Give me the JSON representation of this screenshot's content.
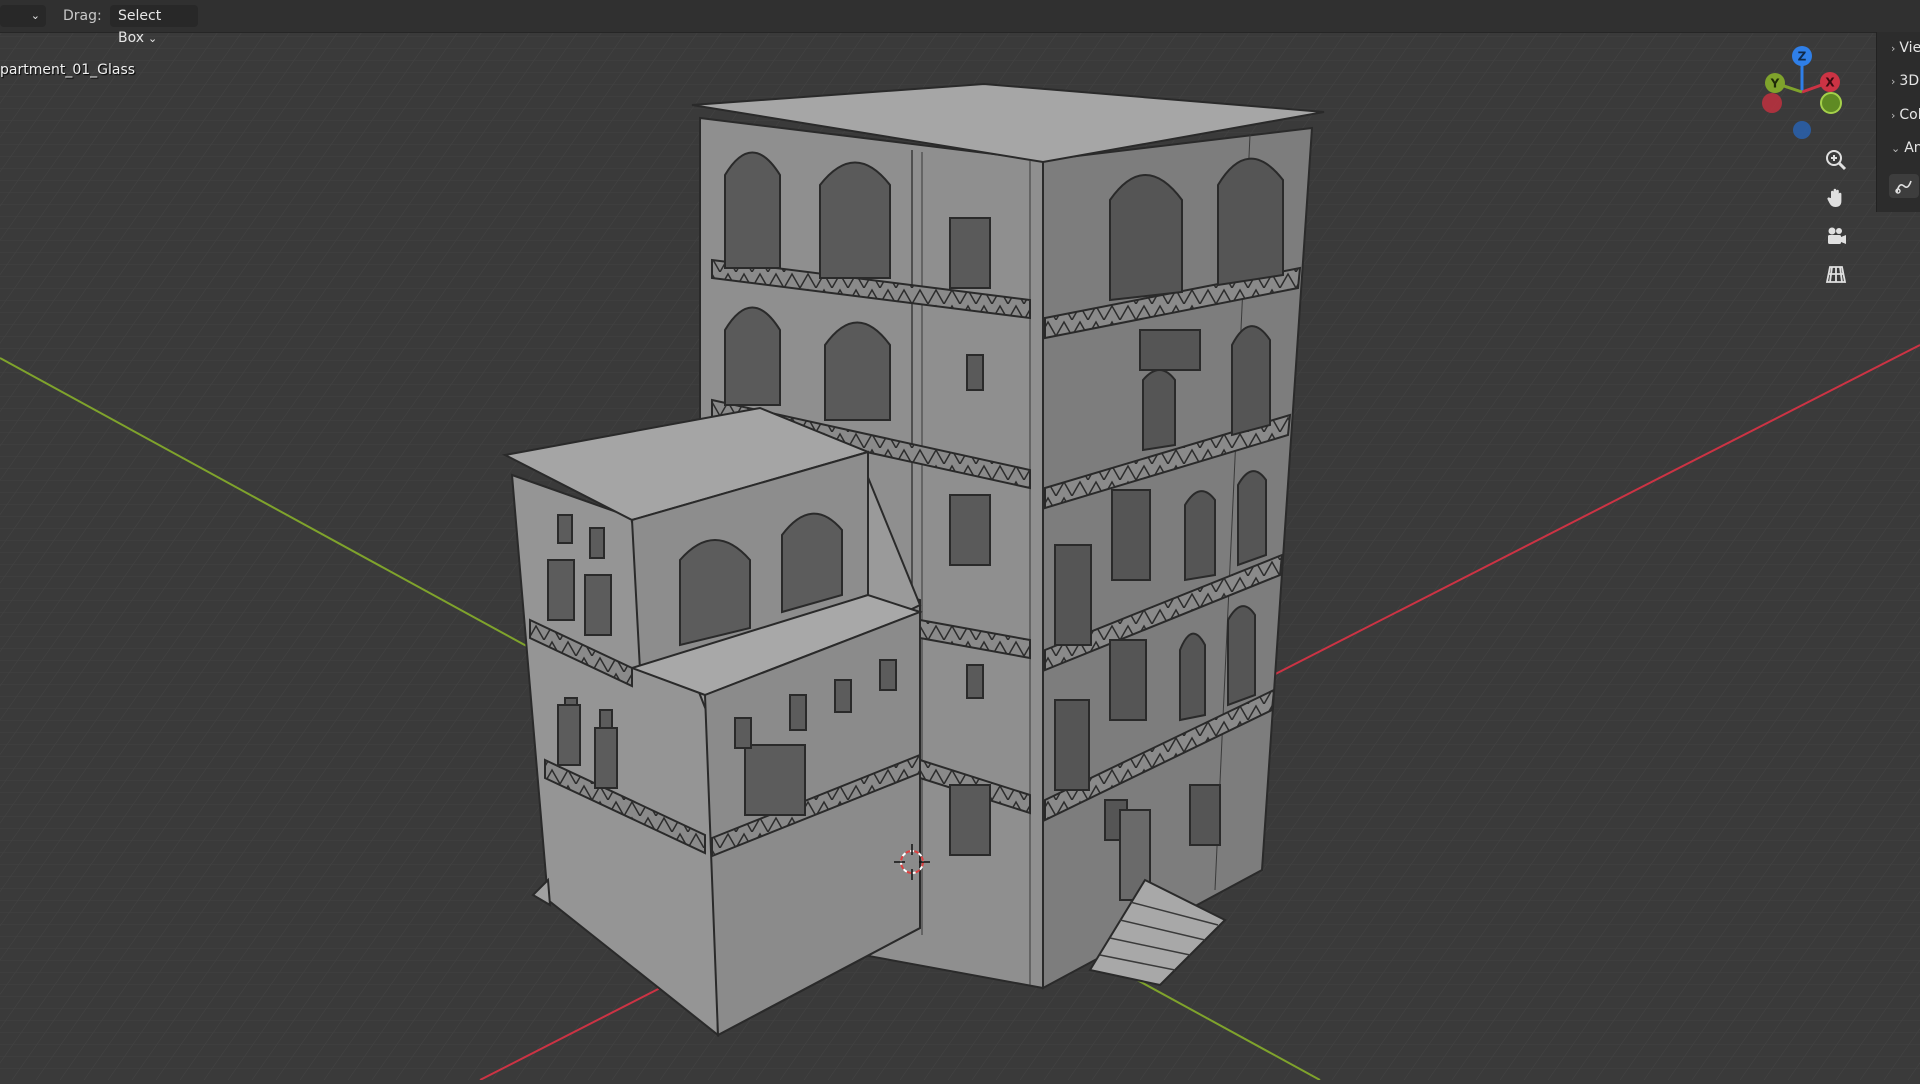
{
  "header": {
    "mode_select": "",
    "drag_label": "Drag:",
    "drag_value": "Select Box"
  },
  "viewport": {
    "object_name": "partment_01_Glass",
    "gizmo": {
      "z": "Z",
      "y": "Y",
      "x": "X"
    }
  },
  "side_panel": {
    "tabs": [
      {
        "label": "Vie"
      },
      {
        "label": "3D"
      },
      {
        "label": "Col"
      },
      {
        "label": "An"
      }
    ]
  },
  "nav_icons": [
    "zoom-icon",
    "hand-pan-icon",
    "camera-icon",
    "grid-projection-icon"
  ],
  "colors": {
    "axis_x": "#cc3344",
    "axis_y": "#7fa32c",
    "axis_z": "#2f7fe8",
    "background": "#3a3a3a"
  }
}
